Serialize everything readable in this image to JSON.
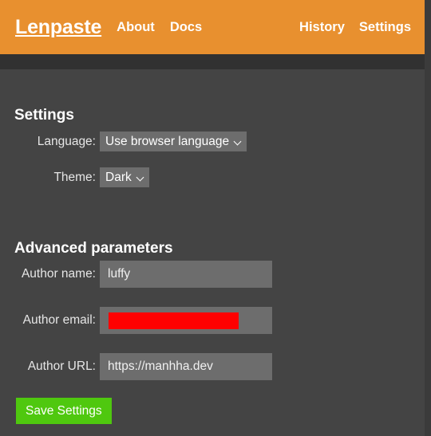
{
  "header": {
    "brand": "Lenpaste",
    "nav_left": [
      {
        "label": "About",
        "name": "nav-link-about"
      },
      {
        "label": "Docs",
        "name": "nav-link-docs"
      }
    ],
    "nav_right": [
      {
        "label": "History",
        "name": "nav-link-history"
      },
      {
        "label": "Settings",
        "name": "nav-link-settings"
      }
    ],
    "background_color": "#e8902f",
    "text_color": "#ffffff"
  },
  "main": {
    "settings_title": "Settings",
    "advanced_title": "Advanced parameters",
    "fields": {
      "language": {
        "label": "Language:",
        "value": "Use browser language",
        "options": [
          "Use browser language"
        ]
      },
      "theme": {
        "label": "Theme:",
        "value": "Dark",
        "options": [
          "Dark"
        ]
      },
      "author_name": {
        "label": "Author name:",
        "value": "luffy",
        "placeholder": ""
      },
      "author_email": {
        "label": "Author email:",
        "value": "",
        "placeholder": "",
        "redacted": true,
        "redaction_color": "#fe0000"
      },
      "author_url": {
        "label": "Author URL:",
        "value": "https://manhha.dev",
        "placeholder": ""
      }
    },
    "save_button": "Save Settings",
    "save_button_color": "#4fc80f",
    "background_color": "#444444",
    "strip_color": "#313131",
    "input_background": "#6d6d6d"
  }
}
